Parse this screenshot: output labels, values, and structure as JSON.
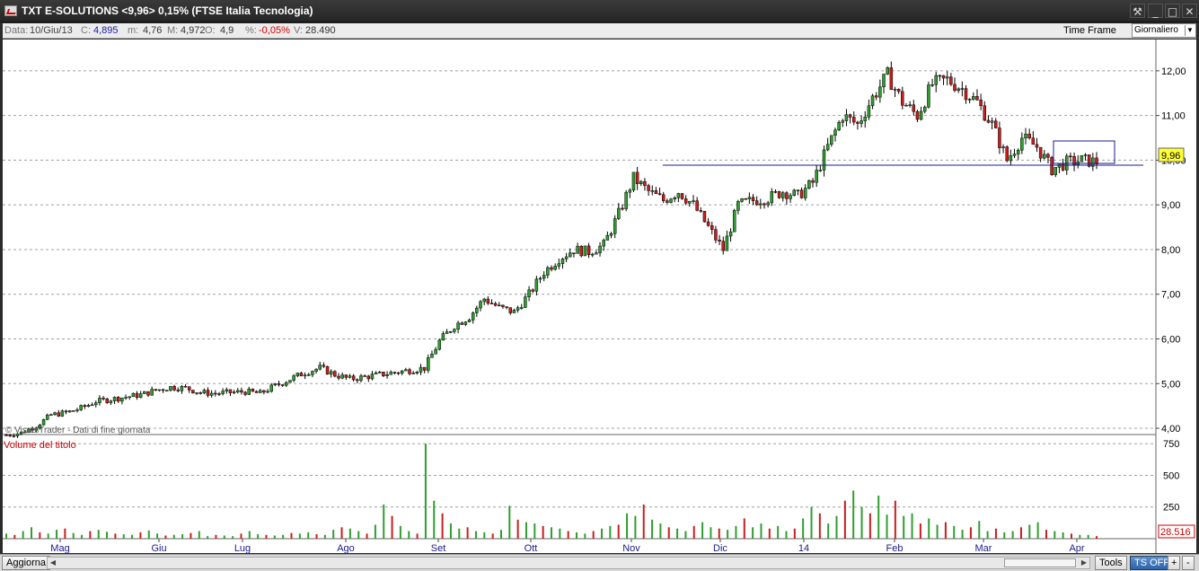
{
  "window": {
    "title": "TXT E-SOLUTIONS <9,96> 0,15%  (FTSE Italia Tecnologia)",
    "buttons": [
      "⚒",
      "_",
      "□",
      "✕"
    ]
  },
  "infobar": {
    "data_label": "Data:",
    "data_value": "10/Giu/13",
    "c_label": "C:",
    "c_value": "4,895",
    "m_label": "m:",
    "m_value": "4,76",
    "M_label": "M:",
    "M_value": "4,972",
    "o_label": "O:",
    "o_value": "4,9",
    "pct_label": "%:",
    "pct_value": "-0,05%",
    "v_label": "V:",
    "v_value": "28.490",
    "timeframe_label": "Time Frame",
    "timeframe_value": "Giornaliero"
  },
  "chart": {
    "price_tag": "9,96",
    "volume_tag": "28.516",
    "watermark": "© VisualTrader - Dati di fine giornata",
    "volume_title": "Volume del titolo",
    "colors": {
      "up": "#2f9e2f",
      "down": "#c81e1e",
      "line": "#1a1a8c",
      "grid": "#a0a0a0"
    }
  },
  "chart_data": {
    "type": "candlestick",
    "price_axis": {
      "ticks": [
        "4,00",
        "5,00",
        "6,00",
        "7,00",
        "8,00",
        "9,00",
        "10,00",
        "11,00",
        "12,00"
      ],
      "ylim": [
        3.9,
        12.5
      ]
    },
    "volume_axis": {
      "ticks": [
        "250",
        "500",
        "750"
      ],
      "ylim": [
        0,
        780
      ]
    },
    "x_ticks": [
      "Mag",
      "Giu",
      "Lug",
      "Ago",
      "Set",
      "Ott",
      "Nov",
      "Dic",
      "14",
      "Feb",
      "Mar",
      "Apr"
    ],
    "grid": true,
    "close_series": [
      {
        "t": 0,
        "c": 3.85
      },
      {
        "t": 4,
        "c": 3.9
      },
      {
        "t": 8,
        "c": 4.05
      },
      {
        "t": 12,
        "c": 4.3
      },
      {
        "t": 16,
        "c": 4.35
      },
      {
        "t": 20,
        "c": 4.45
      },
      {
        "t": 24,
        "c": 4.6
      },
      {
        "t": 28,
        "c": 4.65
      },
      {
        "t": 32,
        "c": 4.7
      },
      {
        "t": 36,
        "c": 4.75
      },
      {
        "t": 40,
        "c": 4.85
      },
      {
        "t": 44,
        "c": 4.92
      },
      {
        "t": 48,
        "c": 4.9
      },
      {
        "t": 52,
        "c": 4.8
      },
      {
        "t": 56,
        "c": 4.78
      },
      {
        "t": 60,
        "c": 4.8
      },
      {
        "t": 64,
        "c": 4.82
      },
      {
        "t": 68,
        "c": 4.78
      },
      {
        "t": 72,
        "c": 4.95
      },
      {
        "t": 76,
        "c": 5.1
      },
      {
        "t": 80,
        "c": 5.25
      },
      {
        "t": 84,
        "c": 5.35
      },
      {
        "t": 88,
        "c": 5.2
      },
      {
        "t": 92,
        "c": 5.1
      },
      {
        "t": 96,
        "c": 5.15
      },
      {
        "t": 100,
        "c": 5.2
      },
      {
        "t": 104,
        "c": 5.25
      },
      {
        "t": 108,
        "c": 5.3
      },
      {
        "t": 112,
        "c": 5.35
      },
      {
        "t": 116,
        "c": 5.95
      },
      {
        "t": 120,
        "c": 6.3
      },
      {
        "t": 124,
        "c": 6.5
      },
      {
        "t": 128,
        "c": 6.9
      },
      {
        "t": 132,
        "c": 6.7
      },
      {
        "t": 136,
        "c": 6.6
      },
      {
        "t": 140,
        "c": 7.0
      },
      {
        "t": 144,
        "c": 7.5
      },
      {
        "t": 148,
        "c": 7.8
      },
      {
        "t": 152,
        "c": 8.0
      },
      {
        "t": 156,
        "c": 7.95
      },
      {
        "t": 160,
        "c": 8.1
      },
      {
        "t": 164,
        "c": 8.8
      },
      {
        "t": 168,
        "c": 9.6
      },
      {
        "t": 172,
        "c": 9.3
      },
      {
        "t": 176,
        "c": 9.1
      },
      {
        "t": 180,
        "c": 9.3
      },
      {
        "t": 184,
        "c": 9.0
      },
      {
        "t": 188,
        "c": 8.5
      },
      {
        "t": 192,
        "c": 8.0
      },
      {
        "t": 196,
        "c": 9.0
      },
      {
        "t": 200,
        "c": 9.1
      },
      {
        "t": 204,
        "c": 9.15
      },
      {
        "t": 208,
        "c": 9.3
      },
      {
        "t": 212,
        "c": 9.2
      },
      {
        "t": 216,
        "c": 9.5
      },
      {
        "t": 220,
        "c": 10.3
      },
      {
        "t": 224,
        "c": 11.0
      },
      {
        "t": 228,
        "c": 10.8
      },
      {
        "t": 232,
        "c": 11.4
      },
      {
        "t": 236,
        "c": 11.9
      },
      {
        "t": 240,
        "c": 11.3
      },
      {
        "t": 244,
        "c": 11.0
      },
      {
        "t": 248,
        "c": 11.7
      },
      {
        "t": 252,
        "c": 11.8
      },
      {
        "t": 256,
        "c": 11.6
      },
      {
        "t": 260,
        "c": 11.3
      },
      {
        "t": 264,
        "c": 10.8
      },
      {
        "t": 268,
        "c": 10.0
      },
      {
        "t": 272,
        "c": 10.5
      },
      {
        "t": 276,
        "c": 10.3
      },
      {
        "t": 280,
        "c": 9.8
      },
      {
        "t": 284,
        "c": 9.95
      },
      {
        "t": 288,
        "c": 10.0
      },
      {
        "t": 292,
        "c": 9.96
      }
    ],
    "volume_series": [
      40,
      30,
      60,
      90,
      50,
      40,
      70,
      80,
      45,
      30,
      60,
      70,
      55,
      40,
      35,
      30,
      50,
      65,
      40,
      25,
      30,
      35,
      45,
      60,
      20,
      30,
      25,
      20,
      40,
      60,
      35,
      30,
      25,
      30,
      45,
      40,
      50,
      35,
      30,
      70,
      90,
      80,
      60,
      40,
      110,
      270,
      180,
      100,
      60,
      40,
      750,
      300,
      200,
      120,
      80,
      90,
      60,
      50,
      40,
      70,
      260,
      150,
      130,
      120,
      100,
      90,
      80,
      60,
      50,
      40,
      60,
      80,
      100,
      110,
      200,
      180,
      270,
      150,
      120,
      90,
      80,
      60,
      100,
      130,
      90,
      80,
      70,
      100,
      160,
      90,
      120,
      80,
      100,
      60,
      80,
      160,
      250,
      200,
      120,
      180,
      300,
      380,
      250,
      200,
      340,
      190,
      300,
      180,
      200,
      120,
      160,
      110,
      130,
      100,
      70,
      90,
      140,
      60,
      80,
      50,
      60,
      90,
      110,
      130,
      70,
      60,
      50,
      40,
      30,
      30,
      20
    ]
  },
  "bottombar": {
    "refresh_button": "Aggiorna",
    "tools_button": "Tools",
    "tsoff_button": "TS OFF",
    "plus_button": "+",
    "minus_button": "-"
  }
}
